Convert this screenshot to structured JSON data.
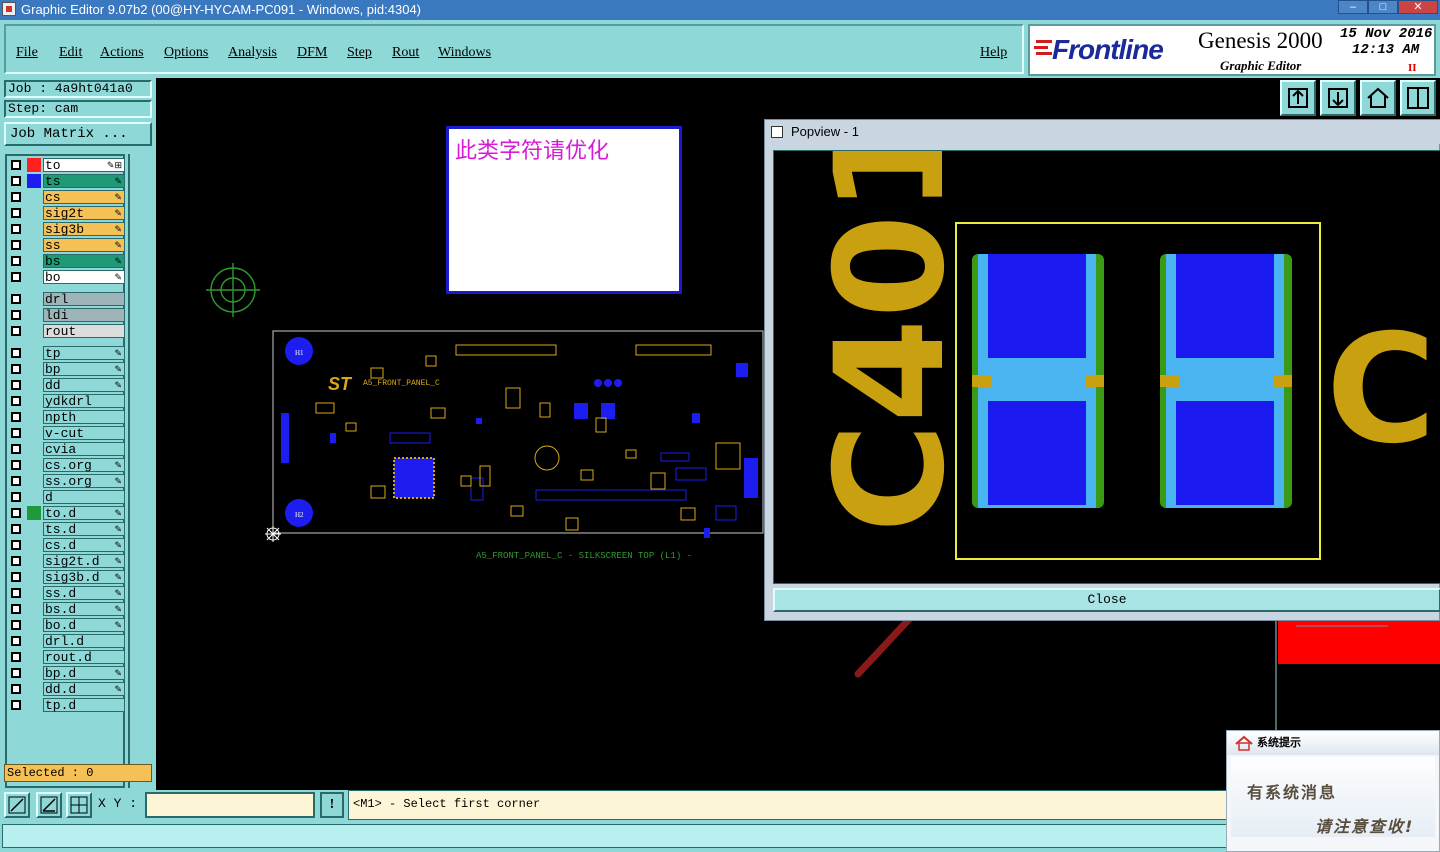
{
  "window": {
    "title": "Graphic Editor 9.07b2 (00@HY-HYCAM-PC091 - Windows, pid:4304)",
    "min": "‒",
    "max": "□",
    "close": "✕"
  },
  "menu": {
    "items": [
      "File",
      "Edit",
      "Actions",
      "Options",
      "Analysis",
      "DFM",
      "Step",
      "Rout",
      "Windows"
    ],
    "help": "Help"
  },
  "brand": {
    "logo": "Frontline",
    "product": "Genesis 2000",
    "subtitle": "Graphic Editor",
    "date": "15 Nov 2016",
    "time": "12:13 AM",
    "pause": "II"
  },
  "job": {
    "job_text": "Job : 4a9ht041a0",
    "step_text": "Step: cam",
    "matrix": "Job Matrix ..."
  },
  "colors": {
    "orange": "#f5c056",
    "green": "#1f9a76",
    "white": "#ffffff",
    "grey": "#9fb4b8",
    "teal": "#8ed8d8",
    "accent": "#3a78c0"
  },
  "layers": [
    {
      "name": "to",
      "bg": "#ffffff",
      "sw": "#ff2020",
      "ed": "✎⊞"
    },
    {
      "name": "ts",
      "bg": "#1f9a76",
      "sw": "#1d1df0",
      "ed": "✎"
    },
    {
      "name": "cs",
      "bg": "#f5c056",
      "sw": "",
      "ed": "✎"
    },
    {
      "name": "sig2t",
      "bg": "#f5c056",
      "sw": "",
      "ed": "✎"
    },
    {
      "name": "sig3b",
      "bg": "#f5c056",
      "sw": "",
      "ed": "✎"
    },
    {
      "name": "ss",
      "bg": "#f5c056",
      "sw": "",
      "ed": "✎"
    },
    {
      "name": "bs",
      "bg": "#1f9a76",
      "sw": "",
      "ed": "✎"
    },
    {
      "name": "bo",
      "bg": "#ffffff",
      "sw": "",
      "ed": "✎"
    },
    {
      "name": "drl",
      "bg": "#9fb4b8",
      "sw": "",
      "ed": ""
    },
    {
      "name": "ldi",
      "bg": "#9fb4b8",
      "sw": "",
      "ed": ""
    },
    {
      "name": "rout",
      "bg": "#dcdcdc",
      "sw": "",
      "ed": ""
    },
    {
      "name": "tp",
      "bg": "#8ed8d8",
      "sw": "",
      "ed": "✎"
    },
    {
      "name": "bp",
      "bg": "#8ed8d8",
      "sw": "",
      "ed": "✎"
    },
    {
      "name": "dd",
      "bg": "#8ed8d8",
      "sw": "",
      "ed": "✎"
    },
    {
      "name": "ydkdrl",
      "bg": "#8ed8d8",
      "sw": "",
      "ed": ""
    },
    {
      "name": "npth",
      "bg": "#8ed8d8",
      "sw": "",
      "ed": ""
    },
    {
      "name": "v-cut",
      "bg": "#8ed8d8",
      "sw": "",
      "ed": ""
    },
    {
      "name": "cvia",
      "bg": "#8ed8d8",
      "sw": "",
      "ed": ""
    },
    {
      "name": "cs.org",
      "bg": "#8ed8d8",
      "sw": "",
      "ed": "✎"
    },
    {
      "name": "ss.org",
      "bg": "#8ed8d8",
      "sw": "",
      "ed": "✎"
    },
    {
      "name": "d",
      "bg": "#8ed8d8",
      "sw": "",
      "ed": ""
    },
    {
      "name": "to.d",
      "bg": "#8ed8d8",
      "sw": "#1f9a3a",
      "ed": "✎"
    },
    {
      "name": "ts.d",
      "bg": "#8ed8d8",
      "sw": "",
      "ed": "✎"
    },
    {
      "name": "cs.d",
      "bg": "#8ed8d8",
      "sw": "",
      "ed": "✎"
    },
    {
      "name": "sig2t.d",
      "bg": "#8ed8d8",
      "sw": "",
      "ed": "✎"
    },
    {
      "name": "sig3b.d",
      "bg": "#8ed8d8",
      "sw": "",
      "ed": "✎"
    },
    {
      "name": "ss.d",
      "bg": "#8ed8d8",
      "sw": "",
      "ed": "✎"
    },
    {
      "name": "bs.d",
      "bg": "#8ed8d8",
      "sw": "",
      "ed": "✎"
    },
    {
      "name": "bo.d",
      "bg": "#8ed8d8",
      "sw": "",
      "ed": "✎"
    },
    {
      "name": "drl.d",
      "bg": "#8ed8d8",
      "sw": "",
      "ed": ""
    },
    {
      "name": "rout.d",
      "bg": "#8ed8d8",
      "sw": "",
      "ed": ""
    },
    {
      "name": "bp.d",
      "bg": "#8ed8d8",
      "sw": "",
      "ed": "✎"
    },
    {
      "name": "dd.d",
      "bg": "#8ed8d8",
      "sw": "",
      "ed": "✎"
    },
    {
      "name": "tp.d",
      "bg": "#8ed8d8",
      "sw": "",
      "ed": ""
    }
  ],
  "selected": "Selected : 0",
  "statusbar": {
    "xy_label": "X Y :",
    "xy_value": "",
    "excl": "!",
    "prompt": "<M1> - Select first corner"
  },
  "note": {
    "text": "此类字符请优化"
  },
  "board": {
    "label_top": "A5_FRONT_PANEL_C",
    "caption": "A5_FRONT_PANEL_C   - SILKSCREEN TOP (L1) -",
    "h1": "H1",
    "h2": "H2"
  },
  "popview": {
    "title": "Popview - 1",
    "designator": "C401",
    "designator_right": "C4",
    "close_label": "Close"
  },
  "notification": {
    "title": "系统提示",
    "line1": "有系统消息",
    "line2": "请注意查收!"
  }
}
